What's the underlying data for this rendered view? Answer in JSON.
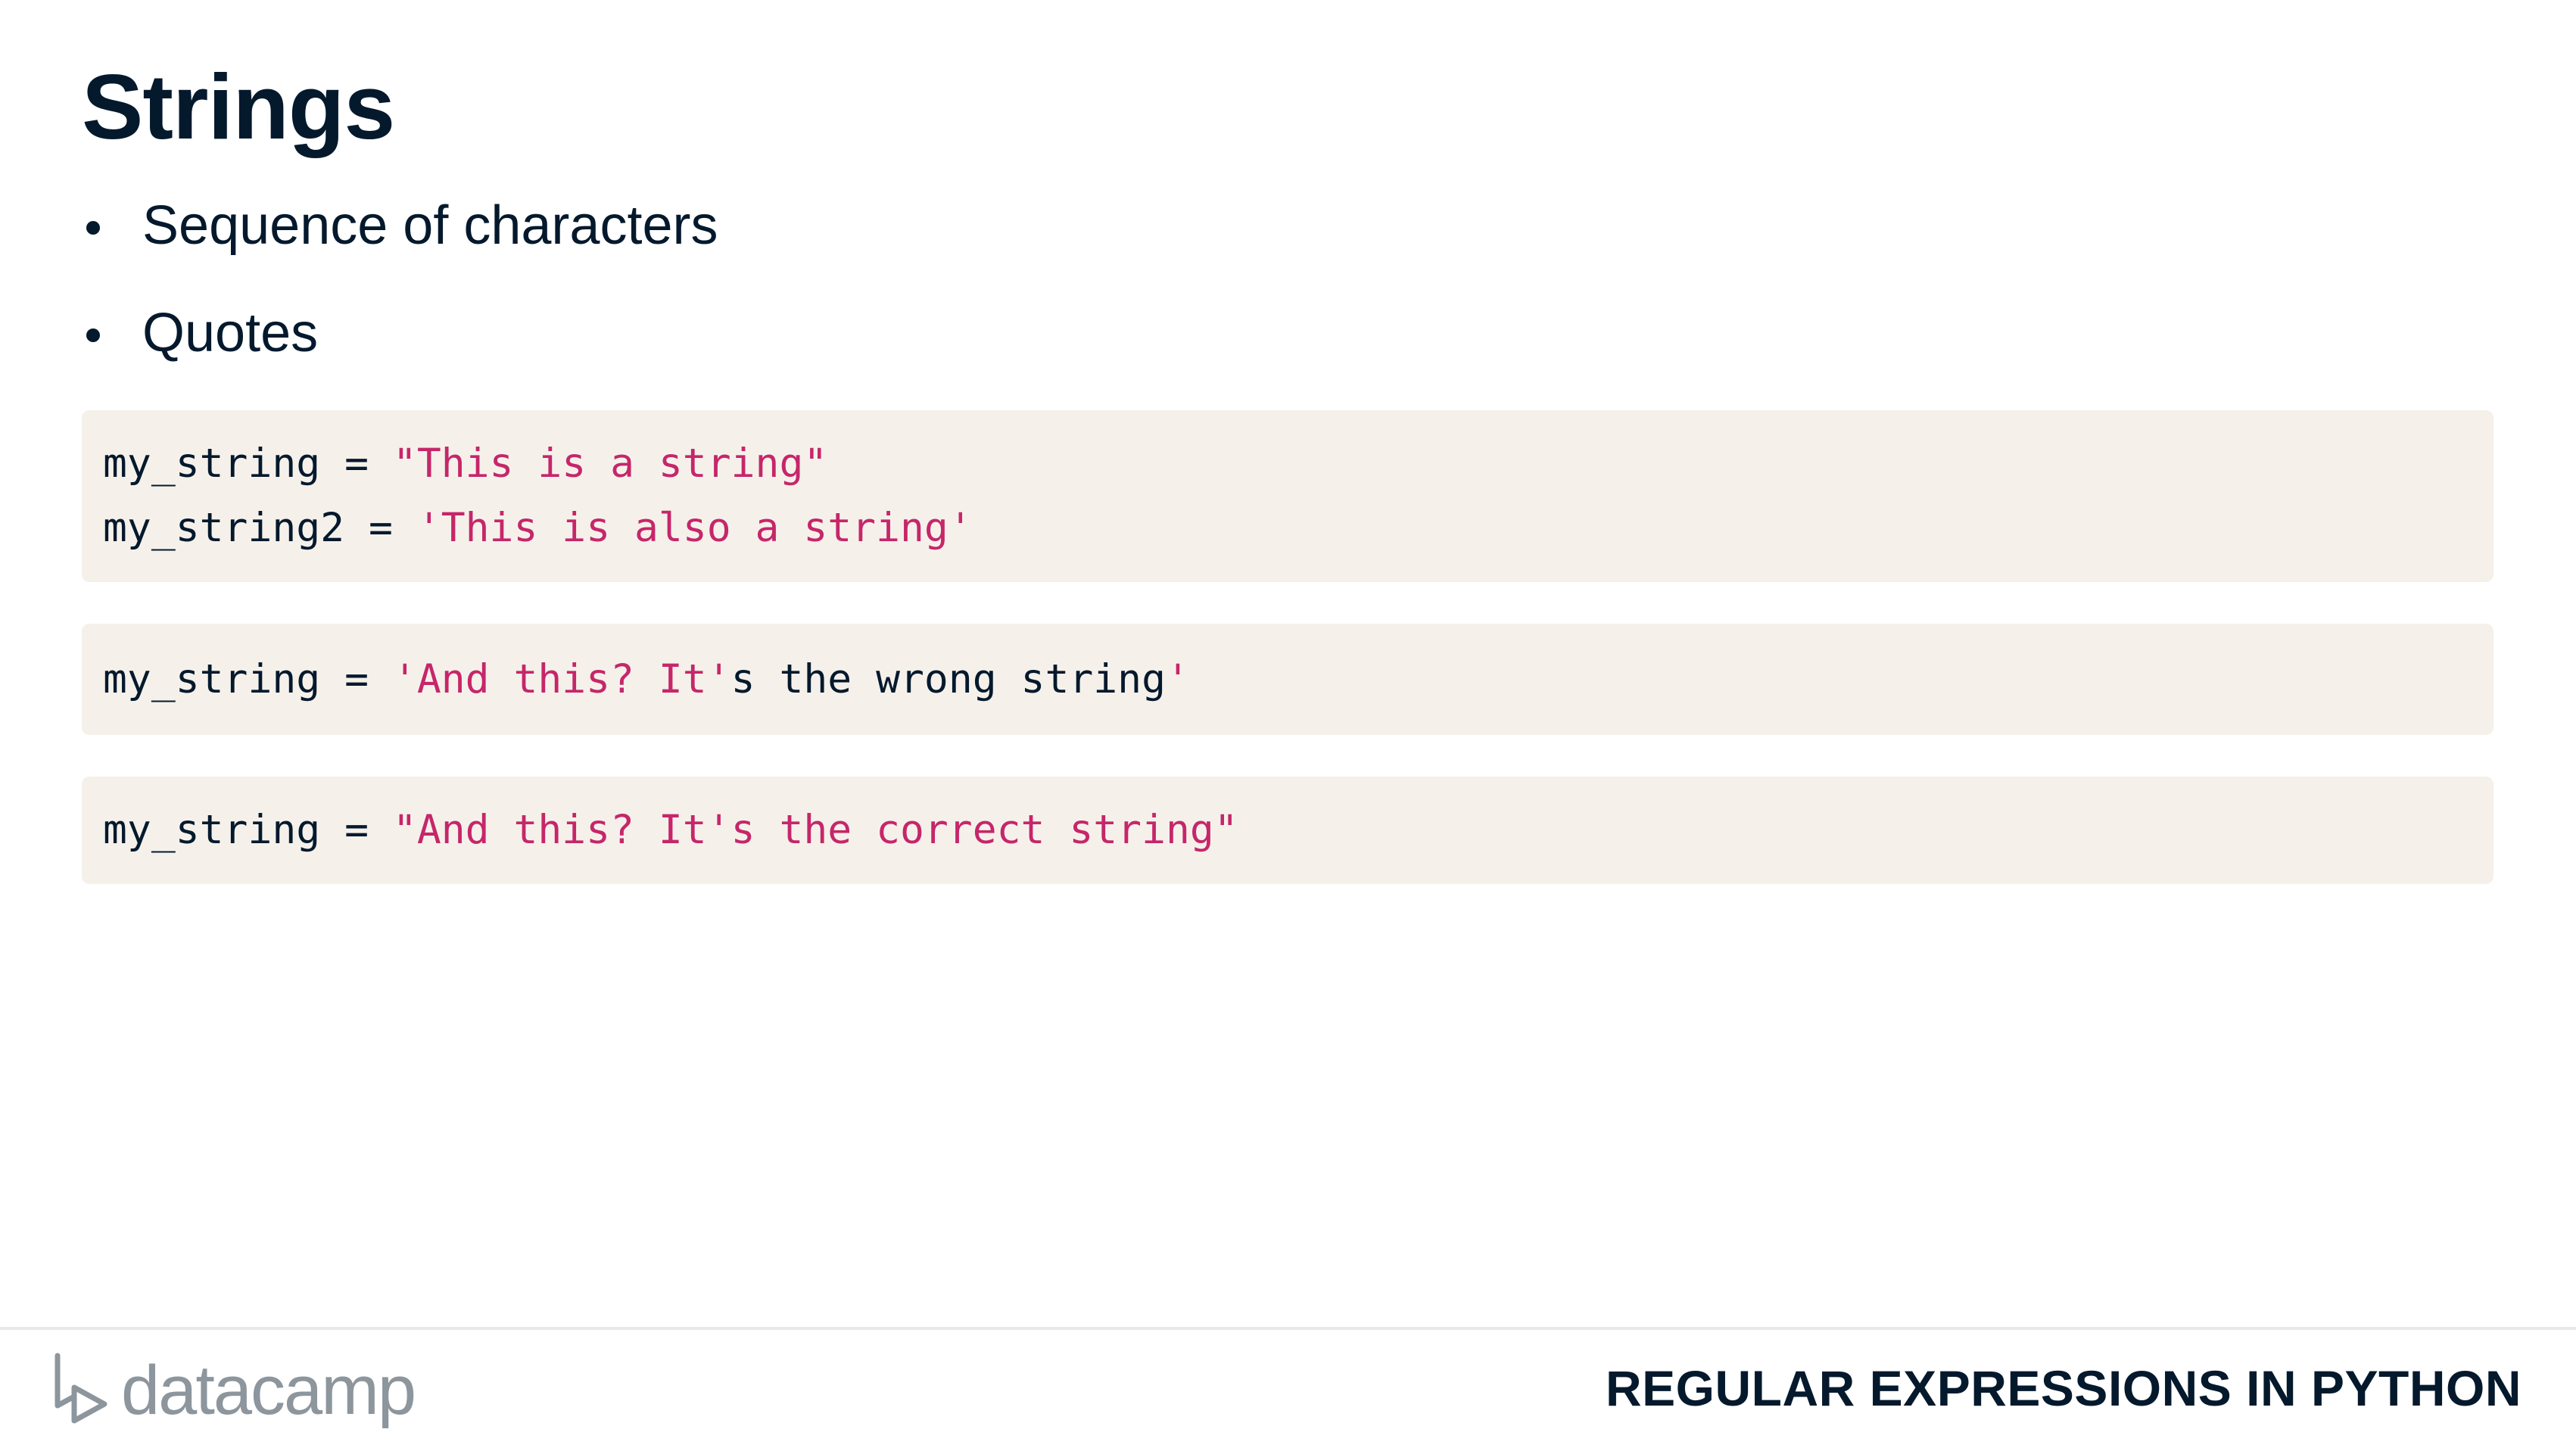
{
  "slide": {
    "title": "Strings",
    "bullets": [
      "Sequence of characters",
      "Quotes"
    ]
  },
  "code_blocks": [
    {
      "lines": [
        {
          "plain": "my_string = ",
          "string": "\"This is a string\"",
          "rest": ""
        },
        {
          "plain": "my_string2 = ",
          "string": "'This is also a string'",
          "rest": ""
        }
      ]
    },
    {
      "lines": [
        {
          "plain": "my_string = ",
          "string": "'And this? It'",
          "rest": "s the wrong string",
          "tail": "'"
        }
      ]
    },
    {
      "lines": [
        {
          "plain": "my_string = ",
          "string": "\"And this? It's the correct string\"",
          "rest": ""
        }
      ]
    }
  ],
  "footer": {
    "logo_text": "datacamp",
    "course_title": "REGULAR EXPRESSIONS IN PYTHON"
  },
  "colors": {
    "text": "#05192d",
    "code_background": "#f5f1ea",
    "string_literal": "#c6266a",
    "logo": "#8d959d"
  }
}
